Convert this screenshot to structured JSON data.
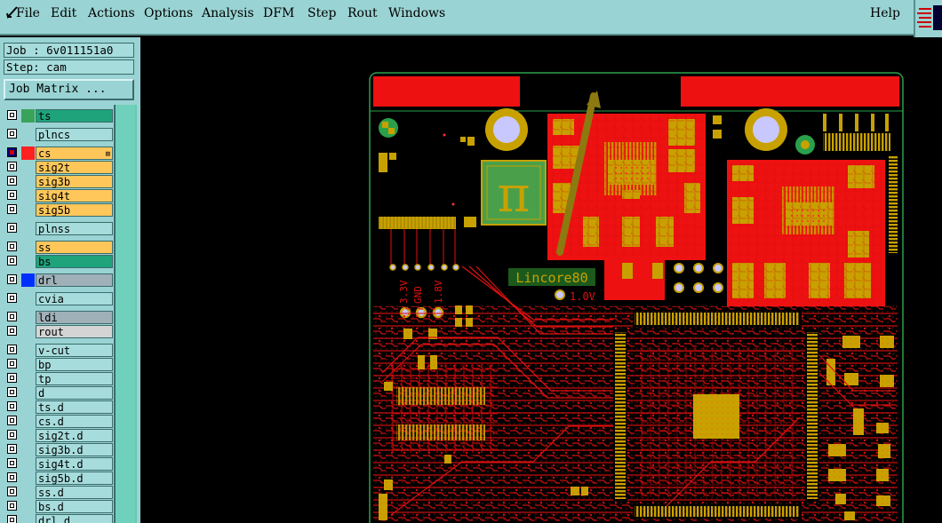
{
  "menu": {
    "file": "File",
    "edit": "Edit",
    "actions": "Actions",
    "options": "Options",
    "analysis": "Analysis",
    "dfm": "DFM",
    "step": "Step",
    "rout": "Rout",
    "windows": "Windows",
    "help": "Help"
  },
  "job_label": "Job : 6v011151a0",
  "step_label": "Step: cam",
  "job_matrix_label": "Job Matrix ...",
  "layers": [
    {
      "name": "ts",
      "checked": false,
      "color": "#3aa35a",
      "bg": "#1ea37a"
    },
    {
      "name": "plncs",
      "checked": false,
      "color": "",
      "bg": "#a7dcdc"
    },
    {
      "name": "cs",
      "checked": true,
      "color": "#ff2020",
      "bg": "#ffc75a",
      "plus": "⊞",
      "sel": "#00007a"
    },
    {
      "name": "sig2t",
      "checked": false,
      "color": "",
      "bg": "#ffc75a"
    },
    {
      "name": "sig3b",
      "checked": false,
      "color": "",
      "bg": "#ffc75a"
    },
    {
      "name": "sig4t",
      "checked": false,
      "color": "",
      "bg": "#ffc75a"
    },
    {
      "name": "sig5b",
      "checked": false,
      "color": "",
      "bg": "#ffc75a"
    },
    {
      "name": "plnss",
      "checked": false,
      "color": "",
      "bg": "#a7dcdc"
    },
    {
      "name": "ss",
      "checked": false,
      "color": "",
      "bg": "#ffc75a"
    },
    {
      "name": "bs",
      "checked": false,
      "color": "",
      "bg": "#1ea37a"
    },
    {
      "name": "drl",
      "checked": false,
      "color": "#0030ff",
      "bg": "#a0b0b8"
    },
    {
      "name": "cvia",
      "checked": false,
      "color": "",
      "bg": "#a7dcdc"
    },
    {
      "name": "ldi",
      "checked": false,
      "color": "",
      "bg": "#a0b0b8"
    },
    {
      "name": "rout",
      "checked": false,
      "color": "",
      "bg": "#d4d4d4"
    },
    {
      "name": "v-cut",
      "checked": false,
      "color": "",
      "bg": "#a7dcdc"
    },
    {
      "name": "bp",
      "checked": false,
      "color": "",
      "bg": "#a7dcdc"
    },
    {
      "name": "tp",
      "checked": false,
      "color": "",
      "bg": "#a7dcdc"
    },
    {
      "name": "d",
      "checked": false,
      "color": "",
      "bg": "#a7dcdc"
    },
    {
      "name": "ts.d",
      "checked": false,
      "color": "",
      "bg": "#a7dcdc"
    },
    {
      "name": "cs.d",
      "checked": false,
      "color": "",
      "bg": "#a7dcdc"
    },
    {
      "name": "sig2t.d",
      "checked": false,
      "color": "",
      "bg": "#a7dcdc"
    },
    {
      "name": "sig3b.d",
      "checked": false,
      "color": "",
      "bg": "#a7dcdc"
    },
    {
      "name": "sig4t.d",
      "checked": false,
      "color": "",
      "bg": "#a7dcdc"
    },
    {
      "name": "sig5b.d",
      "checked": false,
      "color": "",
      "bg": "#a7dcdc"
    },
    {
      "name": "ss.d",
      "checked": false,
      "color": "",
      "bg": "#a7dcdc"
    },
    {
      "name": "bs.d",
      "checked": false,
      "color": "",
      "bg": "#a7dcdc"
    },
    {
      "name": "drl.d",
      "checked": false,
      "color": "",
      "bg": "#a7dcdc"
    }
  ],
  "board": {
    "pi_symbol": "π",
    "silk_label": "Lincore80",
    "volt_10": "1.0V",
    "volt_33": "3.3V",
    "gnd": "GND",
    "volt_18": "1.8V"
  }
}
